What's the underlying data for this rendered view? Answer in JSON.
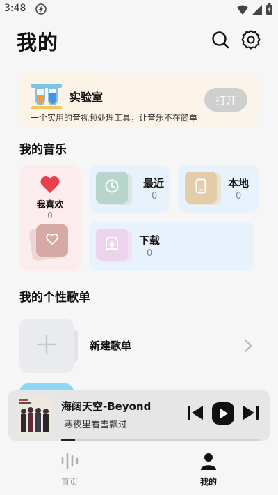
{
  "status_bar": {
    "time": "3:48"
  },
  "header": {
    "title": "我的"
  },
  "lab": {
    "title": "实验室",
    "description": "一个实用的音视频处理工具，让音乐不在简单",
    "button": "打开"
  },
  "my_music": {
    "section_title": "我的音乐",
    "favorites": {
      "label": "我喜欢",
      "count": "0"
    },
    "recent": {
      "label": "最近",
      "count": "0"
    },
    "local": {
      "label": "本地",
      "count": "0"
    },
    "download": {
      "label": "下载",
      "count": "0"
    }
  },
  "playlists": {
    "section_title": "我的个性歌单",
    "new_label": "新建歌单"
  },
  "player": {
    "song": "海阔天空-Beyond",
    "lyric": "寒夜里看雪飘过",
    "progress": 0.07
  },
  "tabs": [
    {
      "label": "首页"
    },
    {
      "label": "我的"
    }
  ],
  "colors": {
    "heart": "#e8414b",
    "accent": "#111111",
    "lab_bg": "#fdf3e6",
    "card_bg": "#e8f2fc",
    "fav_bg": "#fdeced"
  }
}
